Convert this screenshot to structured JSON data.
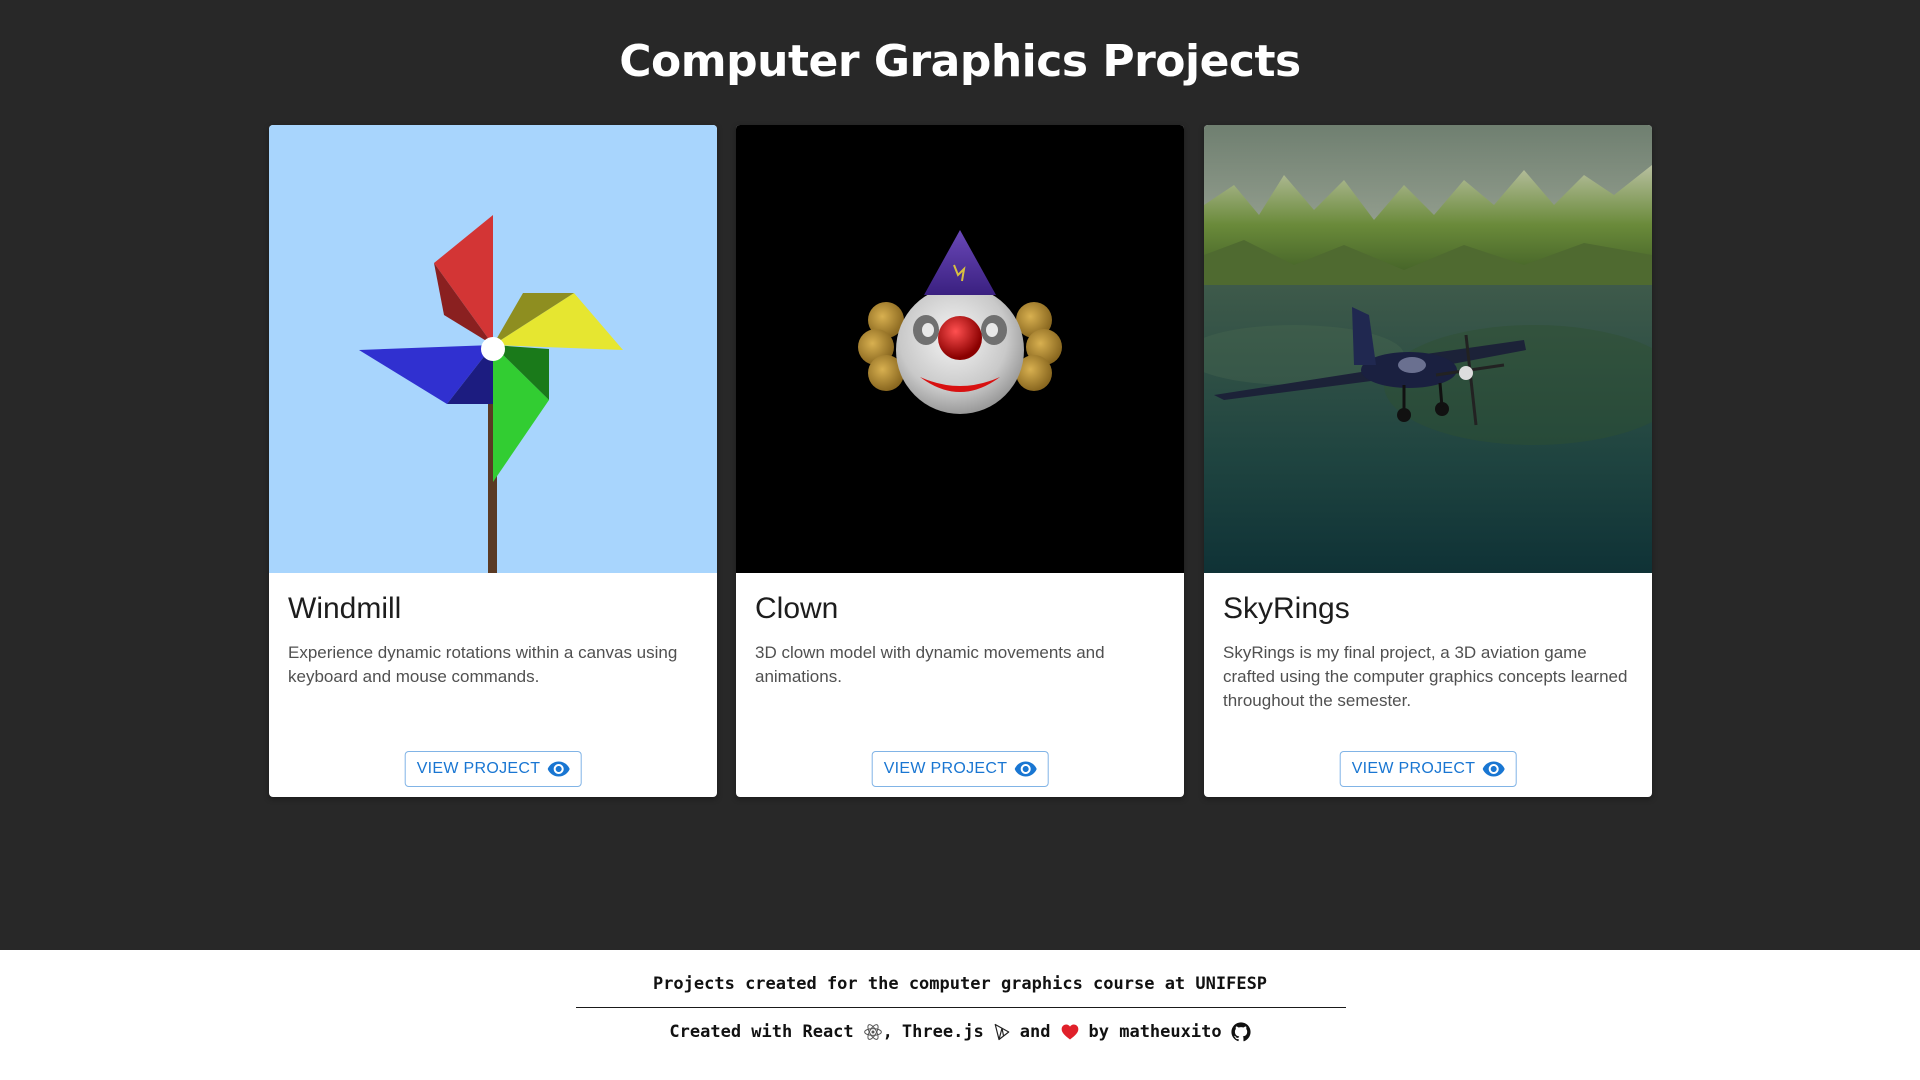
{
  "page": {
    "title": "Computer Graphics Projects"
  },
  "projects": [
    {
      "title": "Windmill",
      "description": "Experience dynamic rotations within a canvas using keyboard and mouse commands.",
      "button_label": "VIEW PROJECT",
      "button_icon": "eye-icon"
    },
    {
      "title": "Clown",
      "description": "3D clown model with dynamic movements and animations.",
      "button_label": "VIEW PROJECT",
      "button_icon": "eye-icon"
    },
    {
      "title": "SkyRings",
      "description": "SkyRings is my final project, a 3D aviation game crafted using the computer graphics concepts learned throughout the semester.",
      "button_label": "VIEW PROJECT",
      "button_icon": "eye-icon"
    }
  ],
  "footer": {
    "line1": "Projects created for the computer graphics course at UNIFESP",
    "created_with": "Created with React",
    "comma": ",",
    "threejs": "Three.js",
    "and": "and",
    "by": "by matheuxito",
    "icons": [
      "react-icon",
      "threejs-icon",
      "heart-icon",
      "github-icon"
    ]
  },
  "colors": {
    "background": "#282828",
    "card": "#ffffff",
    "accent": "#1976d2",
    "footer_bg": "#ffffff"
  }
}
